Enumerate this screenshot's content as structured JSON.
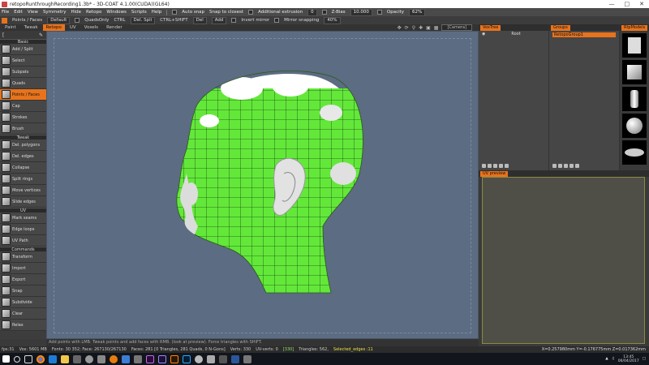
{
  "window": {
    "title": "retopoRunthroughRecording1.3b* - 3D-COAT 4.1.00(CUDA)(GL64)"
  },
  "menubar": {
    "items": [
      "File",
      "Edit",
      "View",
      "Symmetry",
      "Hide",
      "Retopo",
      "Windows",
      "Scripts",
      "Help"
    ],
    "auto_snap": "Auto snap",
    "snap_to_closest": "Snap to closest",
    "additional_extrusion": "Additional extrusion",
    "additional_extrusion_value": "0",
    "z_bias_label": "Z-Bias",
    "z_bias_value": "10.000",
    "opacity_label": "Opacity",
    "opacity_value": "62%"
  },
  "toolbar": {
    "points_faces": "Points / Faces",
    "default_select": "Default",
    "quads_only": "QuadsOnly",
    "ctrl_label": "CTRL",
    "ctrl_select": "Del. Spli",
    "ctrl_shift_label": "CTRL+SHIFT",
    "ctrl_shift_select": "Del",
    "add_select": "Add",
    "invert_mirror": "Invert mirror",
    "mirror_snapping": "Mirror snapping",
    "mirror_snapping_value": "40%"
  },
  "room_tabs": [
    "Paint",
    "Tweak",
    "Retopo",
    "UV",
    "Voxels",
    "Render"
  ],
  "active_tab": "Retopo",
  "camera_select": "[Camera]",
  "left_panel": {
    "sections": [
      {
        "title": "Basic",
        "tools": [
          "Add / Split",
          "Select",
          "Subpats",
          "Quads",
          "Points / Faces",
          "Cap",
          "Strokes",
          "Brush"
        ]
      },
      {
        "title": "Tweak",
        "tools": [
          "Del. polygons",
          "Del. edges",
          "Collapse",
          "Split rings",
          "Move vertices",
          "Slide edges"
        ]
      },
      {
        "title": "UV",
        "tools": [
          "Mark seams",
          "Edge loops",
          "UV Path"
        ]
      },
      {
        "title": "Commands",
        "tools": [
          "Transform",
          "Import",
          "Export",
          "Snap",
          "Subdivide",
          "Clear",
          "Relax"
        ]
      }
    ],
    "active_tool": "Points / Faces"
  },
  "panels": {
    "voxtree": {
      "tab": "VoxTree",
      "root": "Root"
    },
    "groups": {
      "tab": "Groups",
      "selected": "RetopoGroup1"
    },
    "retopo_models": {
      "tab": "RtpModels"
    },
    "uv_preview": {
      "tab": "UV preview"
    }
  },
  "viewport": {
    "hint": "Add points with LMB. Tweak points and add faces with RMB. (look at preview). Force triangles with SHIFT.",
    "mesh_color": "#63e83a"
  },
  "status": {
    "fps": "fps:31",
    "voxel": "Vox: 5601 MB",
    "faces": "Fonts: 30 352; Face: 267130/267130",
    "tris": "Faces: 281 [0 Triangles, 281 Quads, 0 N-Gons]",
    "verts": "Verts: 330",
    "uv_verts": "UV-verts: 0",
    "sel": "[330]",
    "triangles": "Triangles: 562,",
    "selected_edges": "Selected_edges :11",
    "coords": "X=0.257980mm  Y=-0.176775mm  Z=0.017362mm"
  },
  "taskbar": {
    "time": "13:45",
    "date": "06/04/2017"
  }
}
